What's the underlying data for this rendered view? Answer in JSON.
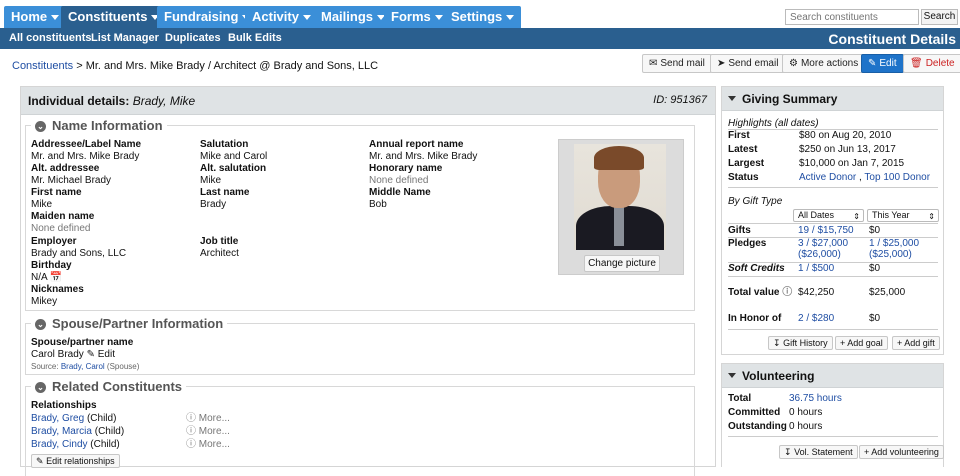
{
  "nav": {
    "tabs": [
      {
        "label": "Home"
      },
      {
        "label": "Constituents"
      },
      {
        "label": "Fundraising"
      },
      {
        "label": "Activity"
      },
      {
        "label": "Mailings"
      },
      {
        "label": "Forms"
      },
      {
        "label": "Settings"
      }
    ],
    "search": {
      "placeholder": "Search constituents",
      "button": "Search"
    }
  },
  "subnav": {
    "items": [
      "All constituents",
      "List Manager",
      "Duplicates",
      "Bulk Edits"
    ],
    "page_title": "Constituent Details"
  },
  "breadcrumb": {
    "root": "Constituents",
    "rest": " > Mr. and Mrs. Mike Brady / Architect @ Brady and Sons, LLC"
  },
  "actions": {
    "send_mail": "Send mail",
    "send_email": "Send email",
    "more": "More actions",
    "edit": "Edit",
    "delete": "Delete"
  },
  "colors": {
    "accent": "#3b8fd8",
    "nav_dark": "#2a5f8f",
    "link": "#1f4ea3",
    "edit_button": "#1e73c9",
    "delete_text": "#cc2222"
  },
  "details": {
    "heading_label": "Individual details:",
    "heading_name": "Brady, Mike",
    "id_text": "ID: 951367",
    "name_info": {
      "title": "Name Information",
      "addressee_label": "Addressee/Label Name",
      "addressee": "Mr. and Mrs. Mike Brady",
      "salutation_label": "Salutation",
      "salutation": "Mike and Carol",
      "annual_label": "Annual report name",
      "annual": "Mr. and Mrs. Mike Brady",
      "alt_addressee_label": "Alt. addressee",
      "alt_addressee": "Mr. Michael Brady",
      "alt_salutation_label": "Alt. salutation",
      "alt_salutation": "Mike",
      "honorary_label": "Honorary name",
      "honorary": "None defined",
      "first_label": "First name",
      "first": "Mike",
      "last_label": "Last name",
      "last": "Brady",
      "middle_label": "Middle Name",
      "middle": "Bob",
      "maiden_label": "Maiden name",
      "maiden": "None defined",
      "employer_label": "Employer",
      "employer": "Brady and Sons, LLC",
      "job_label": "Job title",
      "job": "Architect",
      "birthday_label": "Birthday",
      "birthday": "N/A",
      "nicknames_label": "Nicknames",
      "nicknames": "Mikey",
      "change_picture": "Change picture"
    },
    "spouse": {
      "title": "Spouse/Partner Information",
      "label": "Spouse/partner name",
      "name": "Carol Brady",
      "edit": "Edit",
      "source_label": "Source:",
      "source_link": "Brady, Carol",
      "source_rel": "(Spouse)"
    },
    "related": {
      "title": "Related Constituents",
      "label": "Relationships",
      "items": [
        {
          "name": "Brady, Greg",
          "rel": "(Child)",
          "more": "More..."
        },
        {
          "name": "Brady, Marcia",
          "rel": "(Child)",
          "more": "More..."
        },
        {
          "name": "Brady, Cindy",
          "rel": "(Child)",
          "more": "More..."
        }
      ],
      "edit_button": "Edit relationships"
    }
  },
  "giving": {
    "title": "Giving Summary",
    "highlights": "Highlights (all dates)",
    "first_label": "First",
    "first": "$80 on Aug 20, 2010",
    "latest_label": "Latest",
    "latest": "$250 on Jun 13, 2017",
    "largest_label": "Largest",
    "largest": "$10,000 on Jan 7, 2015",
    "status_label": "Status",
    "status1": "Active Donor",
    "status_sep": ",",
    "status2": "Top 100 Donor",
    "by_type": "By Gift Type",
    "sel1": "All Dates",
    "sel2": "This Year",
    "gifts_label": "Gifts",
    "gifts1": "19 / $15,750",
    "gifts2": "$0",
    "pledges_label": "Pledges",
    "pledges1a": "3 / $27,000",
    "pledges1b": "($26,000)",
    "pledges2a": "1 / $25,000",
    "pledges2b": "($25,000)",
    "soft_label": "Soft Credits",
    "soft1": "1 / $500",
    "soft2": "$0",
    "total_label": "Total value",
    "total1": "$42,250",
    "total2": "$25,000",
    "honor_label": "In Honor of",
    "honor1": "2 / $280",
    "honor2": "$0",
    "btn_history": "Gift History",
    "btn_goal": "Add goal",
    "btn_gift": "Add gift"
  },
  "volunteering": {
    "title": "Volunteering",
    "total_label": "Total",
    "total": "36.75 hours",
    "committed_label": "Committed",
    "committed": "0 hours",
    "outstanding_label": "Outstanding",
    "outstanding": "0 hours",
    "btn_statement": "Vol. Statement",
    "btn_add": "Add volunteering"
  }
}
